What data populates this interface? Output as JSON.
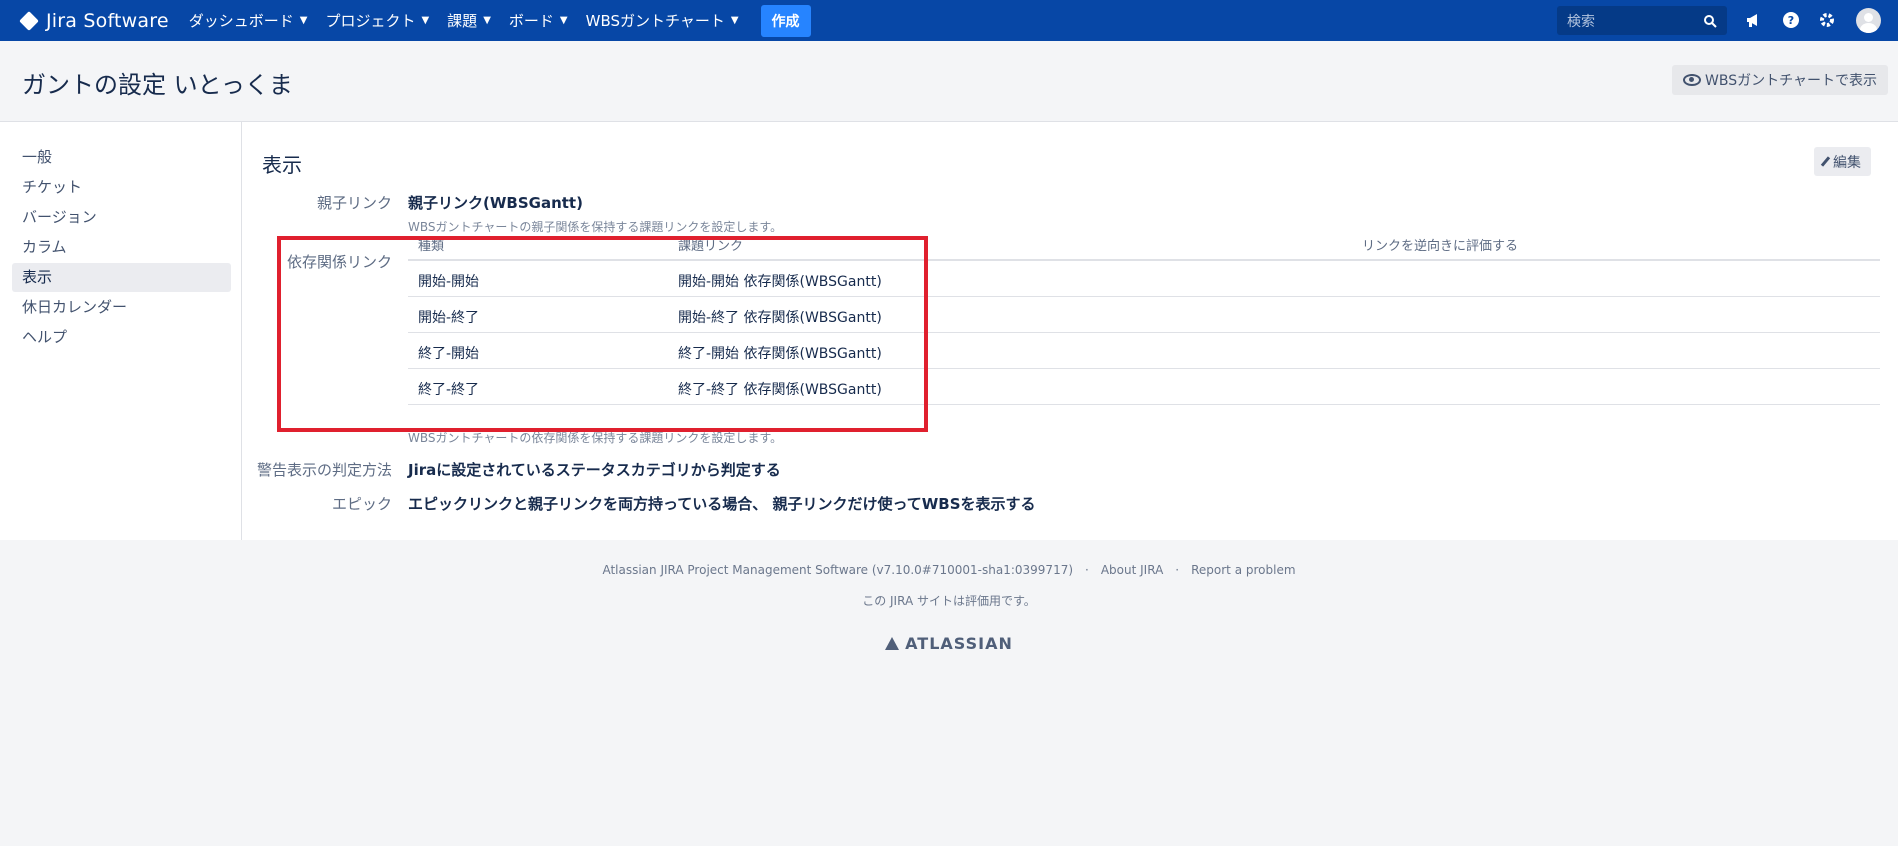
{
  "topnav": {
    "logo": "Jira Software",
    "menus": [
      "ダッシュボード",
      "プロジェクト",
      "課題",
      "ボード",
      "WBSガントチャート"
    ],
    "create_label": "作成",
    "search_placeholder": "検索"
  },
  "header": {
    "title": "ガントの設定 いとっくま",
    "view_button": "WBSガントチャートで表示"
  },
  "sidebar": {
    "items": [
      "一般",
      "チケット",
      "バージョン",
      "カラム",
      "表示",
      "休日カレンダー",
      "ヘルプ"
    ],
    "active": "表示"
  },
  "section": {
    "title": "表示",
    "edit_label": "編集"
  },
  "fields": {
    "parent_link_label": "親子リンク",
    "parent_link_value": "親子リンク(WBSGantt)",
    "parent_link_desc": "WBSガントチャートの親子関係を保持する課題リンクを設定します。",
    "dependency_label": "依存関係リンク",
    "dependency_desc": "WBSガントチャートの依存関係を保持する課題リンクを設定します。",
    "warning_label": "警告表示の判定方法",
    "warning_value": "Jiraに設定されているステータスカテゴリから判定する",
    "epic_label": "エピック",
    "epic_value": "エピックリンクと親子リンクを両方持っている場合、 親子リンクだけ使ってWBSを表示する"
  },
  "dependency_table": {
    "headers": [
      "種類",
      "課題リンク",
      "リンクを逆向きに評価する"
    ],
    "rows": [
      {
        "type": "開始-開始",
        "link": "開始-開始 依存関係(WBSGantt)"
      },
      {
        "type": "開始-終了",
        "link": "開始-終了 依存関係(WBSGantt)"
      },
      {
        "type": "終了-開始",
        "link": "終了-開始 依存関係(WBSGantt)"
      },
      {
        "type": "終了-終了",
        "link": "終了-終了 依存関係(WBSGantt)"
      }
    ]
  },
  "footer": {
    "software": "Atlassian JIRA Project Management Software (v7.10.0#710001-sha1:0399717)",
    "about": "About JIRA",
    "report": "Report a problem",
    "eval": "この JIRA サイトは評価用です。",
    "brand": "ATLASSIAN"
  },
  "colors": {
    "nav_bg": "#0747a6",
    "create_bg": "#2684ff",
    "highlight": "#e0202e"
  }
}
